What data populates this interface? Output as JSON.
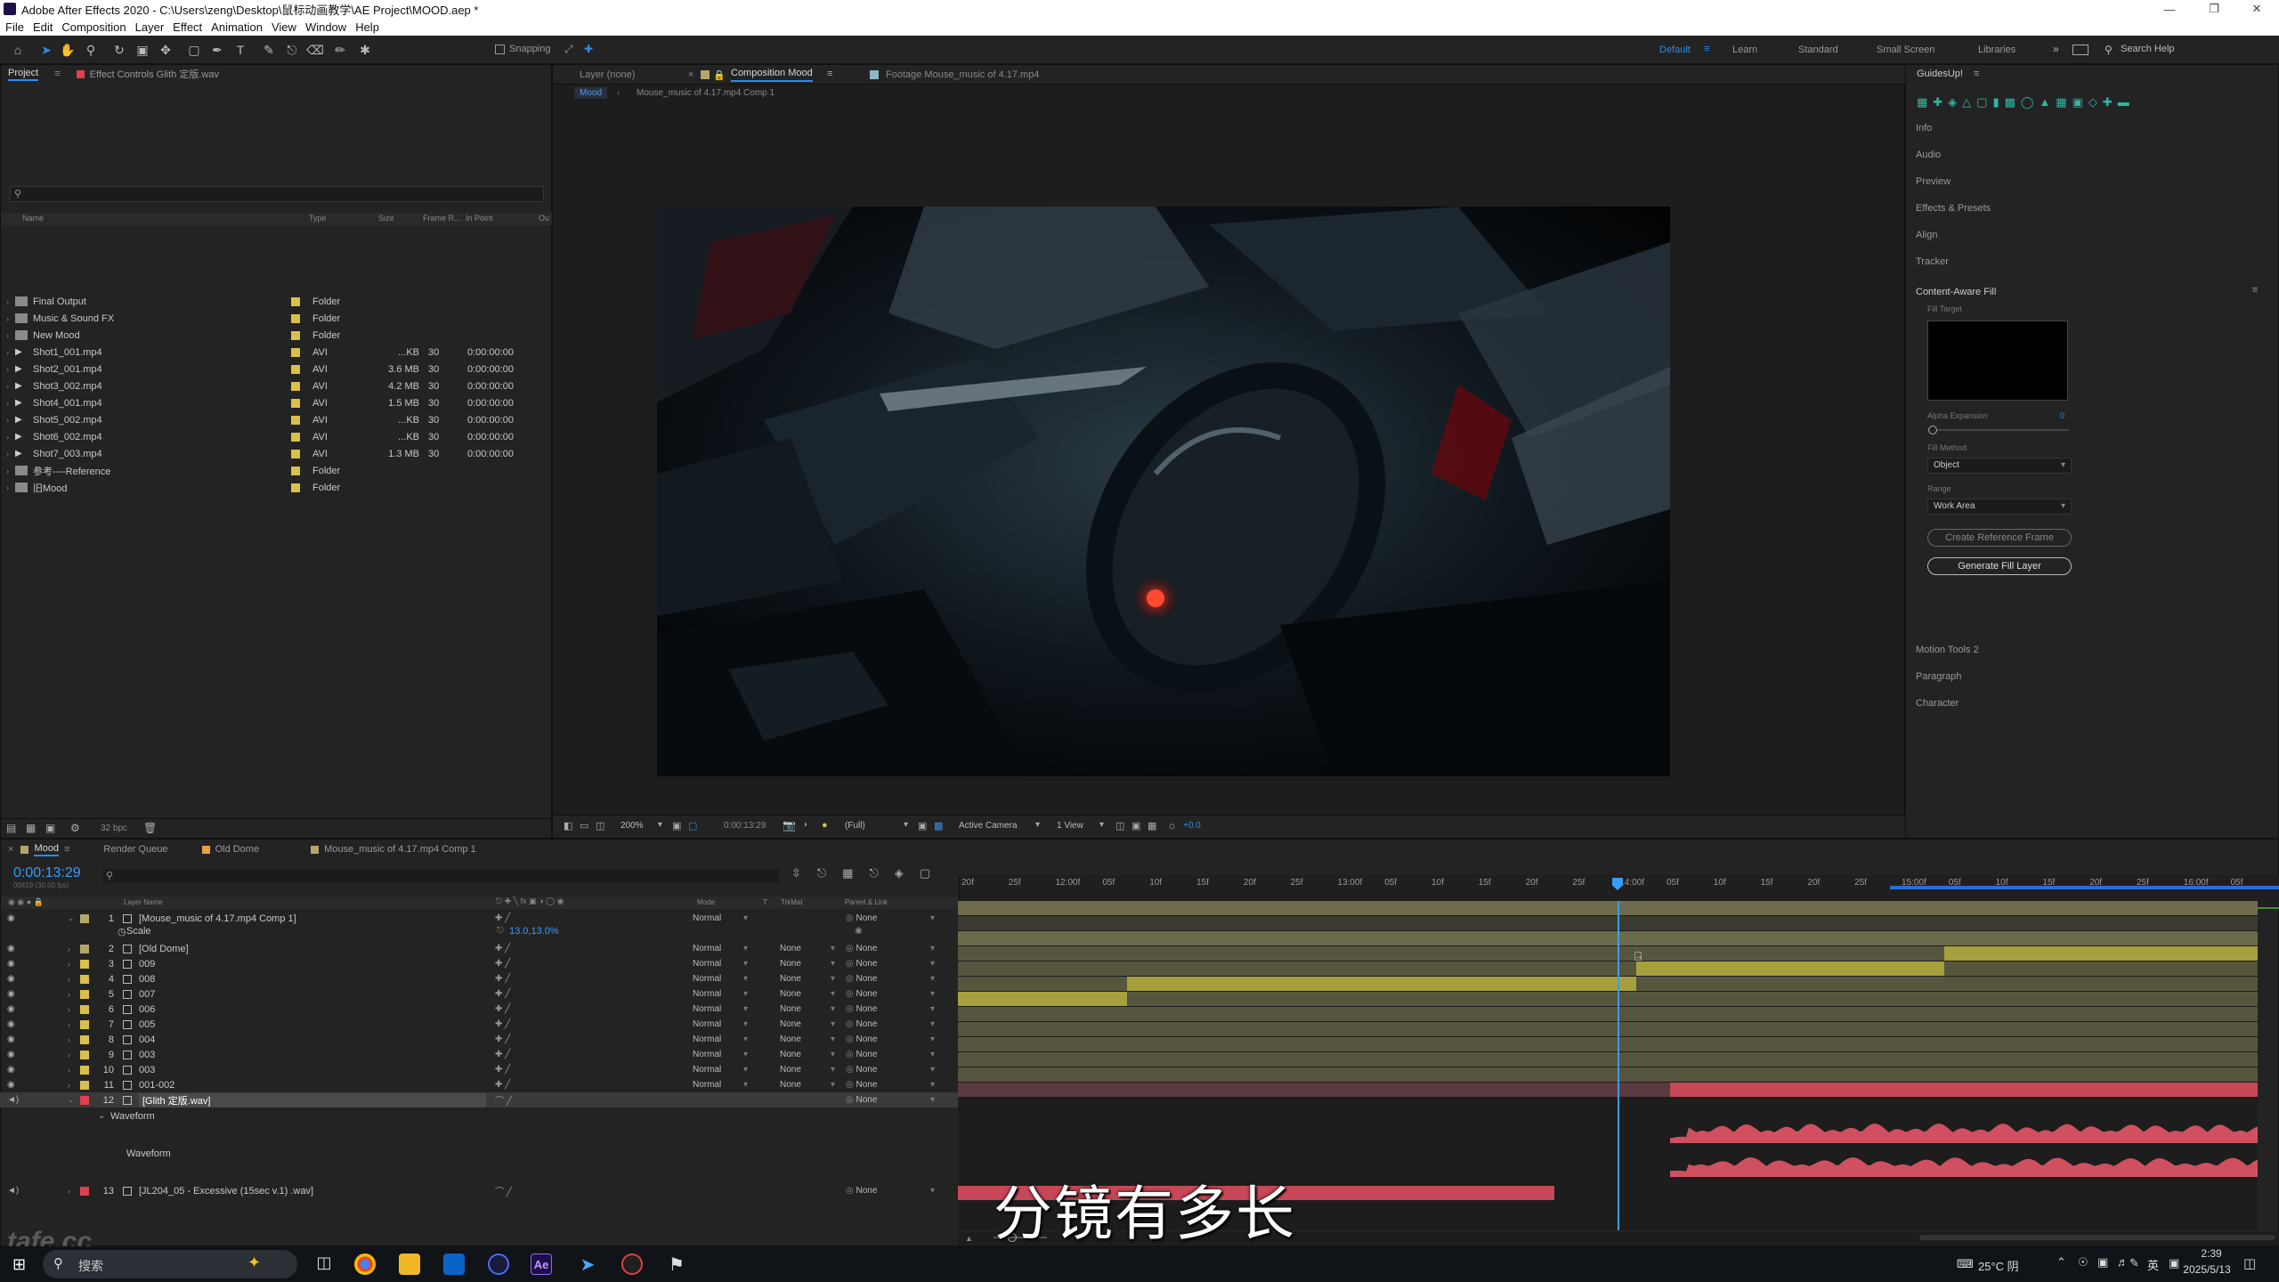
{
  "window": {
    "title": "Adobe After Effects 2020 - C:\\Users\\zeng\\Desktop\\鼠标动画教学\\AE Project\\MOOD.aep *"
  },
  "menu": [
    "File",
    "Edit",
    "Composition",
    "Layer",
    "Effect",
    "Animation",
    "View",
    "Window",
    "Help"
  ],
  "toolbar": {
    "snapping_label": "Snapping",
    "workspaces": [
      "Default",
      "Learn",
      "Standard",
      "Small Screen",
      "Libraries"
    ],
    "search_placeholder": "Search Help"
  },
  "project_panel": {
    "tabs": [
      "Project",
      "Effect Controls Glith 定版.wav"
    ],
    "columns": [
      "Name",
      "Type",
      "Size",
      "Frame R...",
      "In Point",
      "Ou"
    ],
    "items": [
      {
        "name": "Final Output",
        "kind": "folder",
        "type": "Folder",
        "size": "",
        "frame_rate": "",
        "in_point": "",
        "color": "#d9c04a"
      },
      {
        "name": "Music & Sound FX",
        "kind": "folder",
        "type": "Folder",
        "size": "",
        "frame_rate": "",
        "in_point": "",
        "color": "#d9c04a"
      },
      {
        "name": "New Mood",
        "kind": "folder",
        "type": "Folder",
        "size": "",
        "frame_rate": "",
        "in_point": "",
        "color": "#d9c04a"
      },
      {
        "name": "Shot1_001.mp4",
        "kind": "video",
        "type": "AVI",
        "size": "...KB",
        "frame_rate": "30",
        "in_point": "0:00:00:00",
        "color": "#d9c04a"
      },
      {
        "name": "Shot2_001.mp4",
        "kind": "video",
        "type": "AVI",
        "size": "3.6 MB",
        "frame_rate": "30",
        "in_point": "0:00:00:00",
        "color": "#d9c04a"
      },
      {
        "name": "Shot3_002.mp4",
        "kind": "video",
        "type": "AVI",
        "size": "4.2 MB",
        "frame_rate": "30",
        "in_point": "0:00:00:00",
        "color": "#d9c04a"
      },
      {
        "name": "Shot4_001.mp4",
        "kind": "video",
        "type": "AVI",
        "size": "1.5 MB",
        "frame_rate": "30",
        "in_point": "0:00:00:00",
        "color": "#d9c04a"
      },
      {
        "name": "Shot5_002.mp4",
        "kind": "video",
        "type": "AVI",
        "size": "...KB",
        "frame_rate": "30",
        "in_point": "0:00:00:00",
        "color": "#d9c04a"
      },
      {
        "name": "Shot6_002.mp4",
        "kind": "video",
        "type": "AVI",
        "size": "...KB",
        "frame_rate": "30",
        "in_point": "0:00:00:00",
        "color": "#d9c04a"
      },
      {
        "name": "Shot7_003.mp4",
        "kind": "video",
        "type": "AVI",
        "size": "1.3 MB",
        "frame_rate": "30",
        "in_point": "0:00:00:00",
        "color": "#d9c04a"
      },
      {
        "name": "参考----Reference",
        "kind": "folder",
        "type": "Folder",
        "size": "",
        "frame_rate": "",
        "in_point": "",
        "color": "#d9c04a"
      },
      {
        "name": "旧Mood",
        "kind": "folder",
        "type": "Folder",
        "size": "",
        "frame_rate": "",
        "in_point": "",
        "color": "#d9c04a"
      }
    ],
    "bpc": "32 bpc"
  },
  "viewer": {
    "tabs": [
      "Layer (none)",
      "Composition Mood",
      "Footage Mouse_music of 4.17.mp4"
    ],
    "breadcrumb": [
      "Mood",
      "Mouse_music of 4.17.mp4 Comp 1"
    ],
    "zoom": "200%",
    "timecode": "0:00:13:29",
    "resolution": "(Full)",
    "camera": "Active Camera",
    "views": "1 View",
    "exposure": "+0.0"
  },
  "right_panel": {
    "title": "GuidesUp!",
    "sections": [
      "Info",
      "Audio",
      "Preview",
      "Effects & Presets",
      "Align",
      "Tracker"
    ],
    "caf": {
      "title": "Content-Aware Fill",
      "fill_target_label": "Fill Target",
      "alpha_expansion_label": "Alpha Expansion",
      "alpha_expansion_value": "0",
      "fill_method_label": "Fill Method",
      "fill_method_value": "Object",
      "range_label": "Range",
      "range_value": "Work Area",
      "create_ref_label": "Create Reference Frame",
      "generate_label": "Generate Fill Layer"
    },
    "lower_sections": [
      "Motion Tools 2",
      "Paragraph",
      "Character"
    ]
  },
  "timeline": {
    "tabs": [
      "Mood",
      "Render Queue",
      "Old Dome",
      "Mouse_music of 4.17.mp4 Comp 1"
    ],
    "timecode": "0:00:13:29",
    "sub_timecode": "00419 (30.00 fps)",
    "columns": [
      "Layer Name",
      "Mode",
      "T",
      "TrkMat",
      "Parent & Link"
    ],
    "scale_label": "Scale",
    "scale_value": "13.0,13.0%",
    "waveform_label": "Waveform",
    "waveform_label2": "Waveform",
    "ruler": [
      "20f",
      "25f",
      "12:00f",
      "05f",
      "10f",
      "15f",
      "20f",
      "25f",
      "13:00f",
      "05f",
      "10f",
      "15f",
      "20f",
      "25f",
      "14:00f",
      "05f",
      "10f",
      "15f",
      "20f",
      "25f",
      "15:00f",
      "05f",
      "10f",
      "15f",
      "20f",
      "25f",
      "16:00f",
      "05f"
    ],
    "layers": [
      {
        "num": "1",
        "name": "[Mouse_music of 4.17.mp4 Comp 1]",
        "mode": "Normal",
        "trkmat": "",
        "parent": "None",
        "color": "#b5a76a"
      },
      {
        "num": "2",
        "name": "[Old Dome]",
        "mode": "Normal",
        "trkmat": "None",
        "parent": "None",
        "color": "#b5a76a"
      },
      {
        "num": "3",
        "name": "009",
        "mode": "Normal",
        "trkmat": "None",
        "parent": "None",
        "color": "#d9c04a"
      },
      {
        "num": "4",
        "name": "008",
        "mode": "Normal",
        "trkmat": "None",
        "parent": "None",
        "color": "#d9c04a"
      },
      {
        "num": "5",
        "name": "007",
        "mode": "Normal",
        "trkmat": "None",
        "parent": "None",
        "color": "#d9c04a"
      },
      {
        "num": "6",
        "name": "006",
        "mode": "Normal",
        "trkmat": "None",
        "parent": "None",
        "color": "#d9c04a"
      },
      {
        "num": "7",
        "name": "005",
        "mode": "Normal",
        "trkmat": "None",
        "parent": "None",
        "color": "#d9c04a"
      },
      {
        "num": "8",
        "name": "004",
        "mode": "Normal",
        "trkmat": "None",
        "parent": "None",
        "color": "#d9c04a"
      },
      {
        "num": "9",
        "name": "003",
        "mode": "Normal",
        "trkmat": "None",
        "parent": "None",
        "color": "#d9c04a"
      },
      {
        "num": "10",
        "name": "003",
        "mode": "Normal",
        "trkmat": "None",
        "parent": "None",
        "color": "#d9c04a"
      },
      {
        "num": "11",
        "name": "001-002",
        "mode": "Normal",
        "trkmat": "None",
        "parent": "None",
        "color": "#d9c04a"
      },
      {
        "num": "12",
        "name": "[Glith 定版.wav]",
        "mode": "",
        "trkmat": "",
        "parent": "None",
        "color": "#e04050"
      },
      {
        "num": "13",
        "name": "[JL204_05 - Excessive (15sec v.1) .wav]",
        "mode": "",
        "trkmat": "",
        "parent": "None",
        "color": "#e04050"
      }
    ]
  },
  "subtitle": "分镜有多长",
  "taskbar": {
    "search_placeholder": "搜索",
    "weather": "25°C 阴",
    "ime": "英",
    "time": "2:39",
    "date": "2025/5/13"
  },
  "watermark": "tafe.cc",
  "colors": {
    "accent": "#2d8ceb",
    "label_yellow": "#d9c04a",
    "label_red": "#e04050",
    "bar_yellow": "#a6a03c",
    "bar_khaki": "#6b6a4a",
    "bar_red": "#c84858"
  }
}
